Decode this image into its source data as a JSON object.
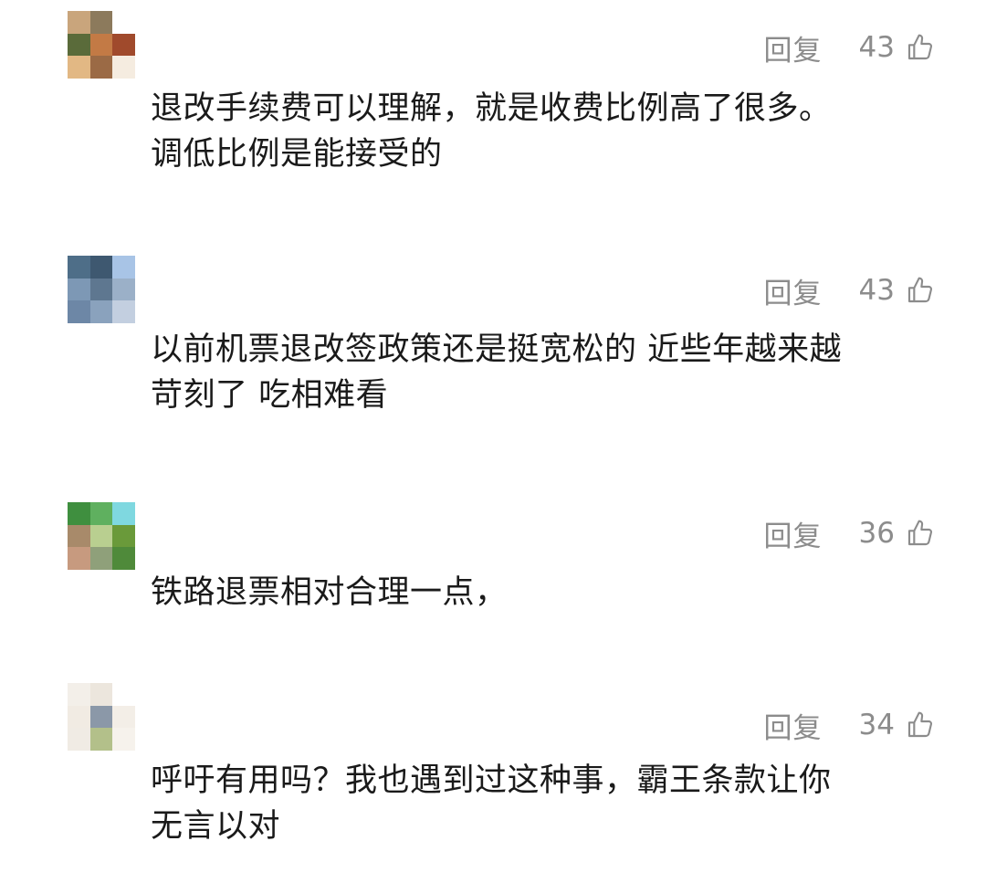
{
  "comments": [
    {
      "username": "",
      "reply_label": "回复",
      "likes": "43",
      "text_lines": [
        "退改手续费可以理解，就是收费比例高了很多。",
        "调低比例是能接受的"
      ],
      "avatar_colors": [
        "#c9a57c",
        "#8c7a5c",
        "#ffffff",
        "#5a6b3a",
        "#c37a45",
        "#a04a2c",
        "#e2b884",
        "#9b6a45",
        "#f5ece0"
      ]
    },
    {
      "username": "",
      "reply_label": "回复",
      "likes": "43",
      "text_lines": [
        "以前机票退改签政策还是挺宽松的 近些年越来越",
        "苛刻了 吃相难看"
      ],
      "avatar_colors": [
        "#4e6e88",
        "#3e5870",
        "#a8c4e6",
        "#7d98b5",
        "#5e7790",
        "#9bb0c8",
        "#6d87a6",
        "#8aa2bd",
        "#c3cfe0"
      ]
    },
    {
      "username": "",
      "reply_label": "回复",
      "likes": "36",
      "text_lines": [
        "铁路退票相对合理一点，"
      ],
      "avatar_colors": [
        "#3f8f3f",
        "#5fb05f",
        "#7fd8e0",
        "#a88a6a",
        "#b9cf90",
        "#6a9a3a",
        "#c79a7f",
        "#8fa07a",
        "#4f8a3a"
      ]
    },
    {
      "username": "",
      "reply_label": "回复",
      "likes": "34",
      "text_lines": [
        "呼吁有用吗？我也遇到过这种事，霸王条款让你",
        "无言以对"
      ],
      "avatar_colors": [
        "#f3efe9",
        "#ece6dd",
        "#ffffff",
        "#f1ebe3",
        "#8b98a8",
        "#f3eee7",
        "#f0ebe4",
        "#b3c08a",
        "#f6f2ec"
      ]
    }
  ],
  "colors": {
    "action_gray": "#8c8c8c",
    "text_dark": "#1a1a1a",
    "background": "#ffffff"
  },
  "icons": {
    "like": "thumbs-up-outline-icon"
  }
}
